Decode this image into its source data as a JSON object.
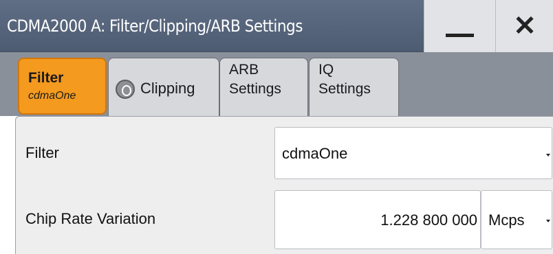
{
  "window": {
    "title": "CDMA2000 A: Filter/Clipping/ARB Settings",
    "minimize_icon": "minimize-icon",
    "close_icon": "close-icon",
    "close_glyph": "✕"
  },
  "tabs": [
    {
      "label": "Filter",
      "sublabel": "cdmaOne",
      "active": true
    },
    {
      "label": "Clipping",
      "icon": "clipping-off-indicator-icon",
      "icon_glyph": ""
    },
    {
      "label_line1": "ARB",
      "label_line2": "Settings"
    },
    {
      "label_line1": "IQ",
      "label_line2": "Settings"
    }
  ],
  "form": {
    "filter": {
      "label": "Filter",
      "value": "cdmaOne",
      "icon": "dropdown-arrow-icon"
    },
    "chip_rate": {
      "label": "Chip Rate Variation",
      "value": "1.228 800 000",
      "unit": "Mcps",
      "icon": "dropdown-arrow-icon"
    }
  },
  "colors": {
    "titlebar": "#5f6e85",
    "active_tab": "#f39a1f",
    "tab_background": "#8a9099",
    "panel": "#eeeeee"
  }
}
